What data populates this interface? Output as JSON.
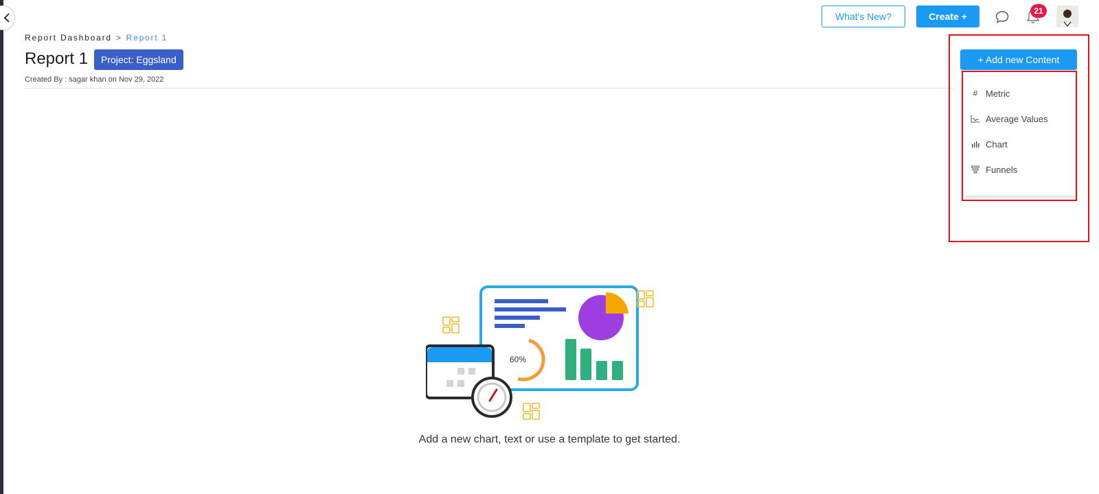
{
  "topbar": {
    "whats_new_label": "What's New?",
    "create_label": "Create +",
    "notification_count": "21"
  },
  "breadcrumb": {
    "parent": "Report Dashboard",
    "separator": ">",
    "current": "Report 1"
  },
  "report": {
    "title": "Report 1",
    "project_badge": "Project: Eggsland",
    "created_by": "Created By : sagar khan on Nov 29, 2022"
  },
  "add_content": {
    "button_label": "+ Add new Content",
    "menu_items": [
      {
        "label": "Metric",
        "icon": "hash-icon"
      },
      {
        "label": "Average Values",
        "icon": "line-chart-icon"
      },
      {
        "label": "Chart",
        "icon": "bar-chart-icon"
      },
      {
        "label": "Funnels",
        "icon": "funnel-icon"
      }
    ]
  },
  "empty_state": {
    "gauge_label": "60%",
    "message": "Add a new chart, text or use a template to get started."
  },
  "colors": {
    "primary": "#1a9af2",
    "badge": "#3a5fc9",
    "notification": "#e5174b",
    "highlight": "#e3101a"
  }
}
